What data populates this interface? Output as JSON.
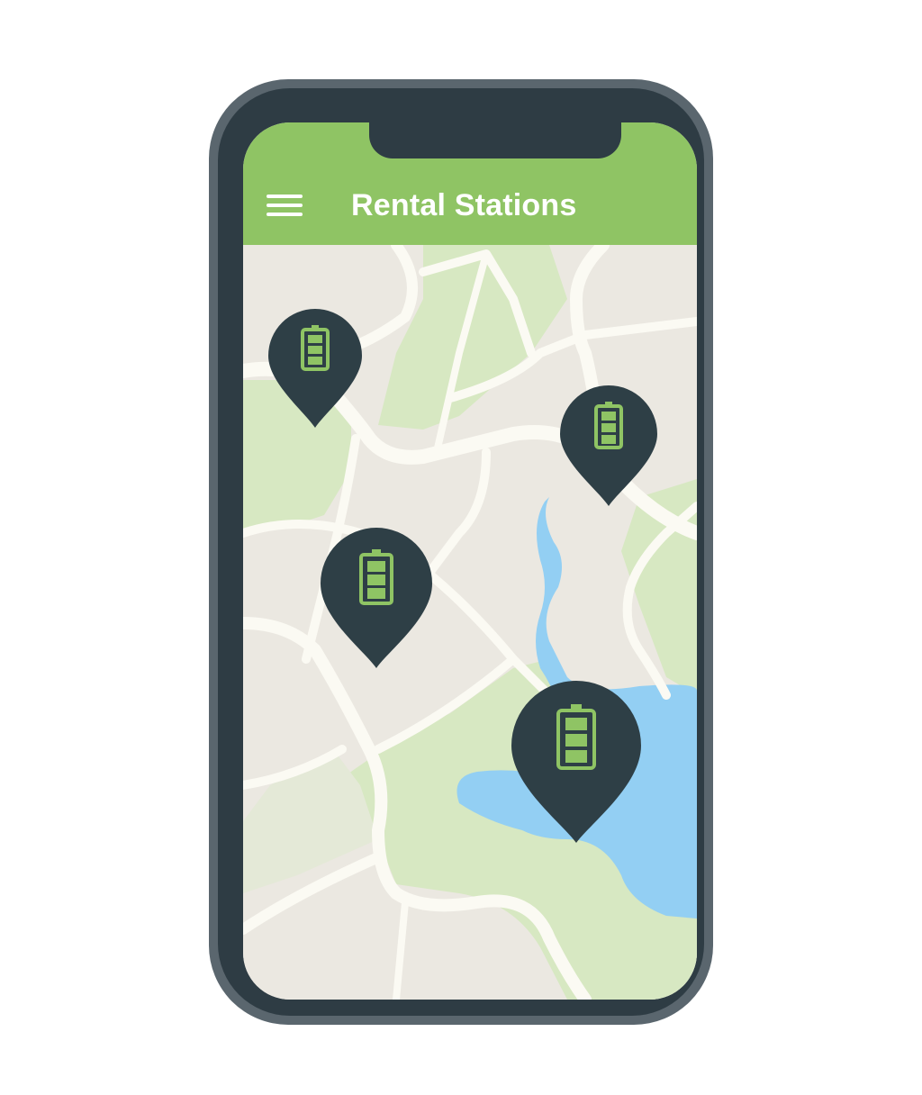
{
  "header": {
    "title": "Rental Stations",
    "menu_icon": "hamburger-menu-icon"
  },
  "map": {
    "land_color": "#ebe8e1",
    "park_color": "#d7e8c2",
    "water_color": "#93cff3",
    "road_color": "#fbfaf3"
  },
  "stations": [
    {
      "icon": "battery-full-icon",
      "charge_level": 1.0
    },
    {
      "icon": "battery-full-icon",
      "charge_level": 1.0
    },
    {
      "icon": "battery-full-icon",
      "charge_level": 1.0
    },
    {
      "icon": "battery-full-icon",
      "charge_level": 1.0
    }
  ],
  "colors": {
    "accent": "#8fc464",
    "pin": "#2e3f46",
    "battery": "#8fc464",
    "phone_body": "#2e3c44",
    "phone_rim": "#5a666e"
  }
}
